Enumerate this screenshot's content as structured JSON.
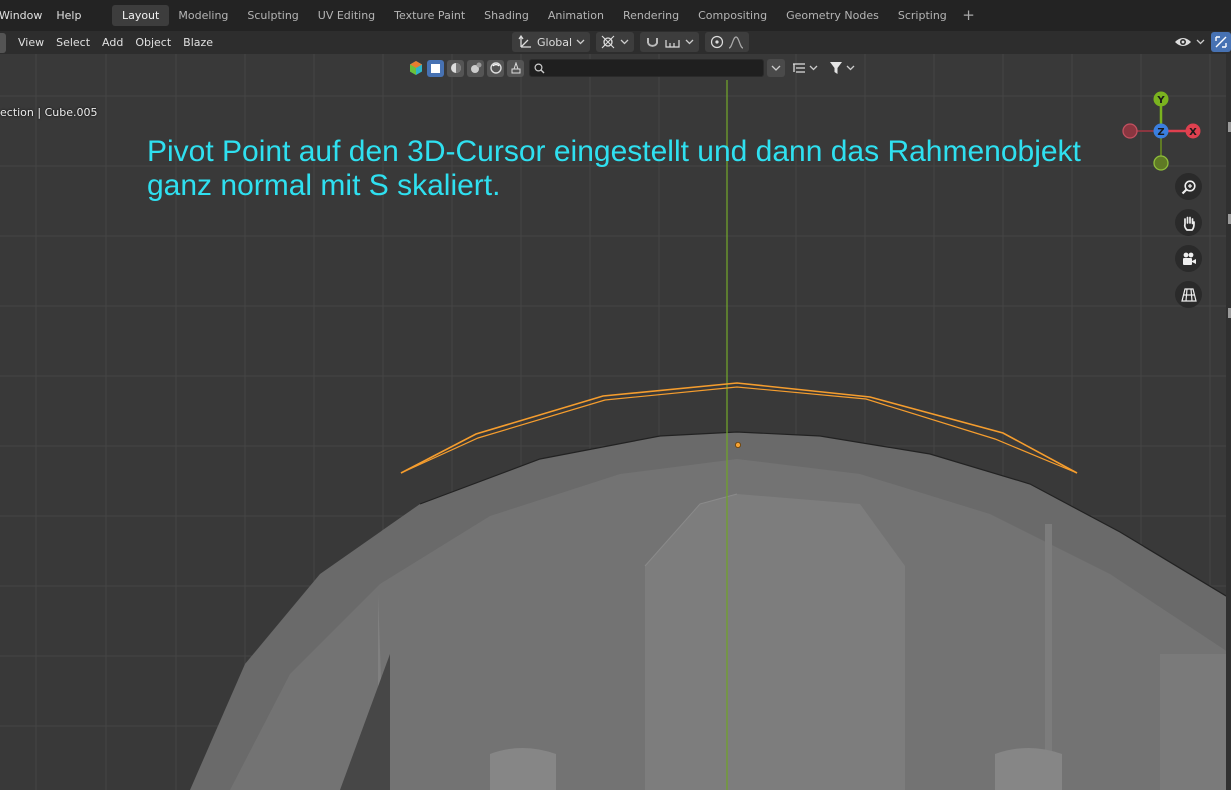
{
  "topbar": {
    "menus": [
      "Window",
      "Help"
    ],
    "tabs": [
      {
        "label": "Layout",
        "active": true
      },
      {
        "label": "Modeling",
        "active": false
      },
      {
        "label": "Sculpting",
        "active": false
      },
      {
        "label": "UV Editing",
        "active": false
      },
      {
        "label": "Texture Paint",
        "active": false
      },
      {
        "label": "Shading",
        "active": false
      },
      {
        "label": "Animation",
        "active": false
      },
      {
        "label": "Rendering",
        "active": false
      },
      {
        "label": "Compositing",
        "active": false
      },
      {
        "label": "Geometry Nodes",
        "active": false
      },
      {
        "label": "Scripting",
        "active": false
      }
    ],
    "add_tab": "+"
  },
  "header": {
    "menus": [
      "View",
      "Select",
      "Add",
      "Object",
      "Blaze"
    ],
    "orientation": "Global"
  },
  "viewport": {
    "collection_label": "ection | Cube.005",
    "annotation_line1": "Pivot Point auf den 3D-Cursor eingestellt und dann das Rahmenobjekt",
    "annotation_line2": "ganz normal mit S skaliert.",
    "search_placeholder": ""
  },
  "gizmo": {
    "y_label": "Y",
    "z_label": "Z",
    "x_label": "X"
  },
  "colors": {
    "accent": "#4772b3",
    "annotation": "#2fe0f0",
    "selection_outline": "#f59d2e",
    "axis_x": "#e0404f",
    "axis_y": "#7ab31f",
    "axis_z": "#3a7fe0"
  }
}
